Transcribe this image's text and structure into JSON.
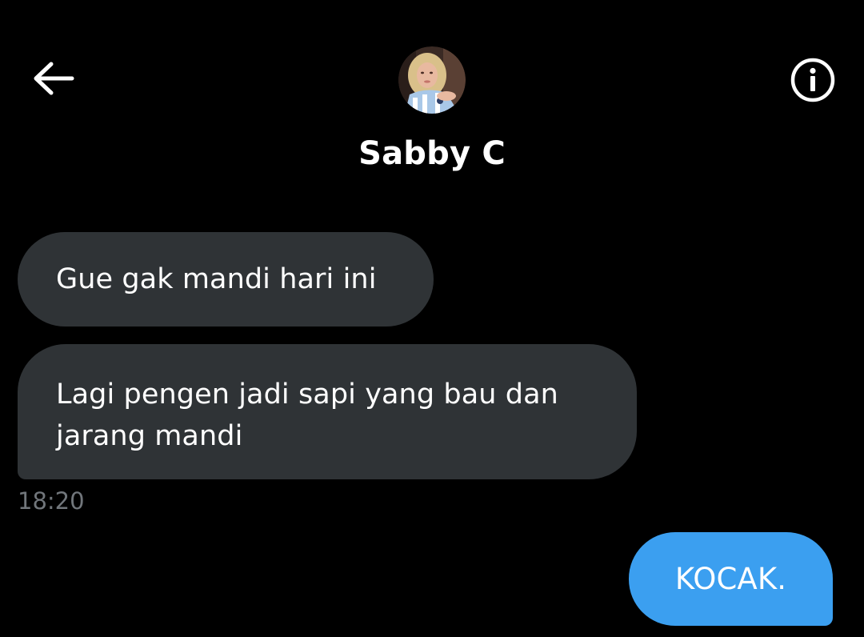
{
  "header": {
    "contact_name": "Sabby C",
    "back_icon": "arrow-left-icon",
    "info_icon": "info-circle-icon",
    "avatar": "contact-avatar"
  },
  "messages": [
    {
      "direction": "received",
      "text": "Gue gak mandi hari ini"
    },
    {
      "direction": "received",
      "text": "Lagi pengen jadi sapi yang bau dan jarang mandi"
    },
    {
      "direction": "sent",
      "text": "KOCAK."
    }
  ],
  "received_group_timestamp": "18:20",
  "colors": {
    "background": "#000000",
    "received_bubble": "#2f3336",
    "sent_bubble": "#3b9ff0",
    "timestamp": "#71767b",
    "text": "#ffffff"
  }
}
